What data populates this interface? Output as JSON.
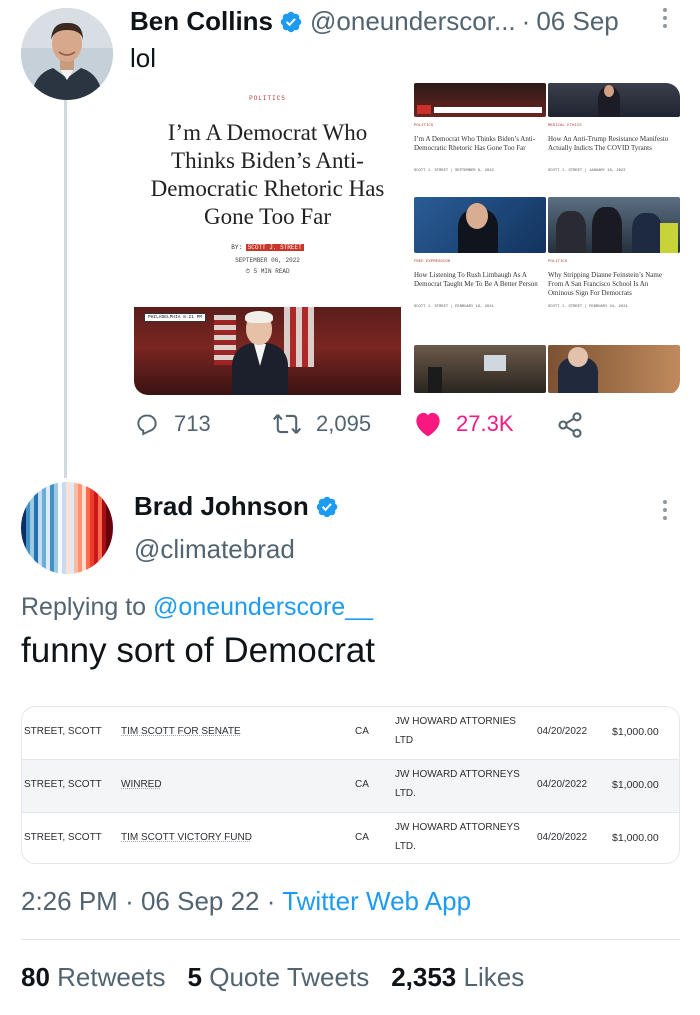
{
  "tweet1": {
    "name": "Ben Collins",
    "handle": "@oneunderscor...",
    "separator": "·",
    "date": "06 Sep",
    "text": "lol",
    "actions": {
      "replies": "713",
      "retweets": "2,095",
      "likes": "27.3K"
    }
  },
  "article": {
    "section": "POLITICS",
    "title": "I’m A Democrat Who Thinks Biden’s Anti-Democratic Rhetoric Has Gone Too Far",
    "by_label": "BY:",
    "author": "SCOTT J. STREET",
    "date": "SEPTEMBER 06, 2022",
    "read_time": "⏱ 5 MIN READ",
    "photo_badge": "PHILADELPHIA 8:21 PM",
    "related": [
      {
        "category": "POLITICS",
        "headline": "I’m A Democrat Who Thinks Biden’s Anti-Democratic Rhetoric Has Gone Too Far",
        "meta": "SCOTT J. STREET  |  SEPTEMBER 6, 2022"
      },
      {
        "category": "MEDICAL ETHICS",
        "headline": "How An Anti-Trump Resistance Manifesto Actually Indicts The COVID Tyrants",
        "meta": "SCOTT J. STREET  |  JANUARY 18, 2022"
      },
      {
        "category": "FREE EXPRESSION",
        "headline": "How Listening To Rush Limbaugh As A Democrat Taught Me To Be A Better Person",
        "meta": "SCOTT J. STREET  |  FEBRUARY 19, 2021"
      },
      {
        "category": "POLITICS",
        "headline": "Why Stripping Dianne Feinstein’s Name From A San Francisco School Is An Ominous Sign For Democrats",
        "meta": "SCOTT J. STREET  |  FEBRUARY 24, 2021"
      }
    ]
  },
  "tweet2": {
    "name": "Brad Johnson",
    "handle": "@climatebrad",
    "replying_label": "Replying to",
    "replying_to": "@oneunderscore__",
    "text": "funny sort of Democrat"
  },
  "donations": {
    "rows": [
      {
        "donor": "STREET, SCOTT",
        "recipient": "TIM SCOTT FOR SENATE",
        "state": "CA",
        "employer_l1": "JW HOWARD ATTORNIES",
        "employer_l2": "LTD",
        "date": "04/20/2022",
        "amount": "$1,000.00"
      },
      {
        "donor": "STREET, SCOTT",
        "recipient": "WINRED",
        "state": "CA",
        "employer_l1": "JW HOWARD ATTORNEYS",
        "employer_l2": "LTD.",
        "date": "04/20/2022",
        "amount": "$1,000.00"
      },
      {
        "donor": "STREET, SCOTT",
        "recipient": "TIM SCOTT VICTORY FUND",
        "state": "CA",
        "employer_l1": "JW HOWARD ATTORNEYS",
        "employer_l2": "LTD.",
        "date": "04/20/2022",
        "amount": "$1,000.00"
      }
    ]
  },
  "footer": {
    "time": "2:26 PM",
    "sep": "·",
    "date": "06 Sep 22",
    "source": "Twitter Web App",
    "stats": {
      "retweets_count": "80",
      "retweets_label": "Retweets",
      "quotes_count": "5",
      "quotes_label": "Quote Tweets",
      "likes_count": "2,353",
      "likes_label": "Likes"
    }
  },
  "colors": {
    "accent": "#1d9bf0",
    "like": "#f91880",
    "muted": "#536471"
  }
}
